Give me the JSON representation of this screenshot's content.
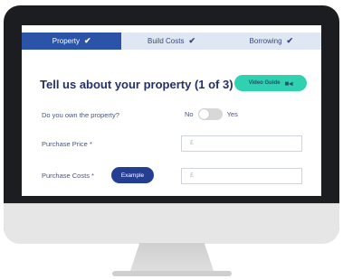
{
  "tabs": [
    {
      "label": "Property",
      "active": true,
      "check_icon": "check-icon"
    },
    {
      "label": "Build Costs",
      "active": false,
      "check_icon": "check-icon"
    },
    {
      "label": "Borrowing",
      "active": false,
      "check_icon": "check-icon"
    }
  ],
  "heading": "Tell us about your property (1 of 3)",
  "video_guide": {
    "label": "Video Guide",
    "icon": "video-camera-icon"
  },
  "own_property": {
    "label": "Do you own the property?",
    "toggle_no": "No",
    "toggle_yes": "Yes",
    "value": "No"
  },
  "purchase_price": {
    "label": "Purchase Price *",
    "placeholder": "£"
  },
  "purchase_costs": {
    "label": "Purchase Costs *",
    "example_label": "Example",
    "placeholder": "£"
  },
  "colors": {
    "accent": "#2b53a7",
    "teal": "#2fd1b1",
    "heading": "#23306a",
    "example_button": "#243e92"
  }
}
